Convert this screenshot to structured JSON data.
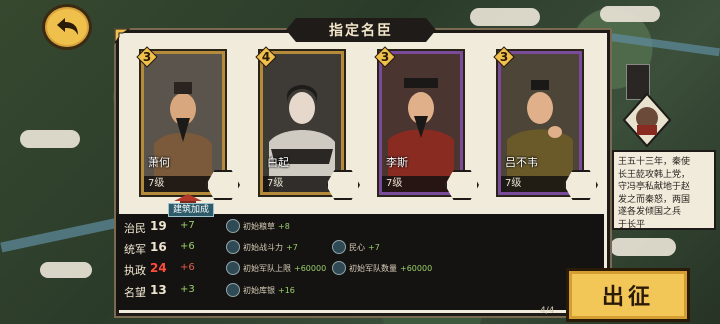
{
  "title": "指定名臣",
  "generals": [
    {
      "name": "萧何",
      "level": "7级",
      "stars": "3",
      "frame": "gold"
    },
    {
      "name": "白起",
      "level": "7级",
      "stars": "4",
      "frame": "gold"
    },
    {
      "name": "李斯",
      "level": "7级",
      "stars": "3",
      "frame": "purple"
    },
    {
      "name": "吕不韦",
      "level": "7级",
      "stars": "3",
      "frame": "purple"
    }
  ],
  "build_bonus_label": "建筑加成",
  "stats": [
    {
      "label": "治民",
      "value": "19",
      "bonus": "+7",
      "effects": [
        {
          "icon": "grain-icon",
          "text": "初始粮草",
          "num": "+8"
        }
      ]
    },
    {
      "label": "统军",
      "value": "16",
      "bonus": "+6",
      "effects": [
        {
          "icon": "sword-icon",
          "text": "初始战斗力",
          "num": "+7"
        },
        {
          "icon": "heart-icon",
          "text": "民心",
          "num": "+7"
        }
      ]
    },
    {
      "label": "执政",
      "value": "24",
      "bonus": "+6",
      "effects": [
        {
          "icon": "troops-icon",
          "text": "初始军队上限",
          "num": "+60000"
        },
        {
          "icon": "troops-count-icon",
          "text": "初始军队数量",
          "num": "+60000"
        }
      ]
    },
    {
      "label": "名望",
      "value": "13",
      "bonus": "+3",
      "effects": [
        {
          "icon": "gold-icon",
          "text": "初始库银",
          "num": "+16"
        }
      ]
    }
  ],
  "side_text": [
    "王五十三年，秦使",
    "长王龁攻韩上党，",
    "守冯亭私献地于赵",
    "发之而秦怒，两国",
    "遂各发倾国之兵",
    "于长平"
  ],
  "go_button": "出征",
  "pager": "4/4"
}
